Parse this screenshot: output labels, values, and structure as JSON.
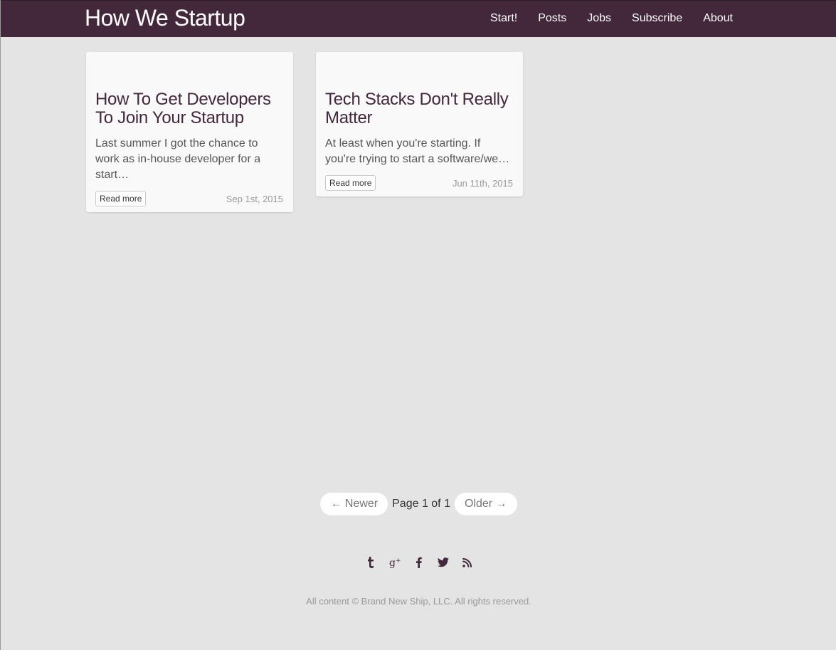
{
  "header": {
    "brand": "How We Startup",
    "nav": [
      {
        "label": "Start!"
      },
      {
        "label": "Posts"
      },
      {
        "label": "Jobs"
      },
      {
        "label": "Subscribe"
      },
      {
        "label": "About"
      }
    ]
  },
  "posts": [
    {
      "title": "How To Get Developers To Join Your Startup",
      "excerpt": "Last summer I got the chance to work as in-house developer for a start…",
      "button": "Read more",
      "date": "Sep 1st, 2015"
    },
    {
      "title": "Tech Stacks Don't Really Matter",
      "excerpt": "At least when you're starting. If you're trying to start a software/we…",
      "button": "Read more",
      "date": "Jun 11th, 2015"
    }
  ],
  "pagination": {
    "newer": "← Newer",
    "status": "Page 1 of 1",
    "older": "Older →"
  },
  "social": [
    {
      "icon": "tumblr-icon"
    },
    {
      "icon": "google-plus-icon"
    },
    {
      "icon": "facebook-icon"
    },
    {
      "icon": "twitter-icon"
    },
    {
      "icon": "rss-icon"
    }
  ],
  "footer": {
    "copyright": "All content © Brand New Ship, LLC. All rights reserved."
  },
  "colors": {
    "brand": "#43283b",
    "background": "#e4e4e4",
    "card": "#f9f9f9"
  }
}
